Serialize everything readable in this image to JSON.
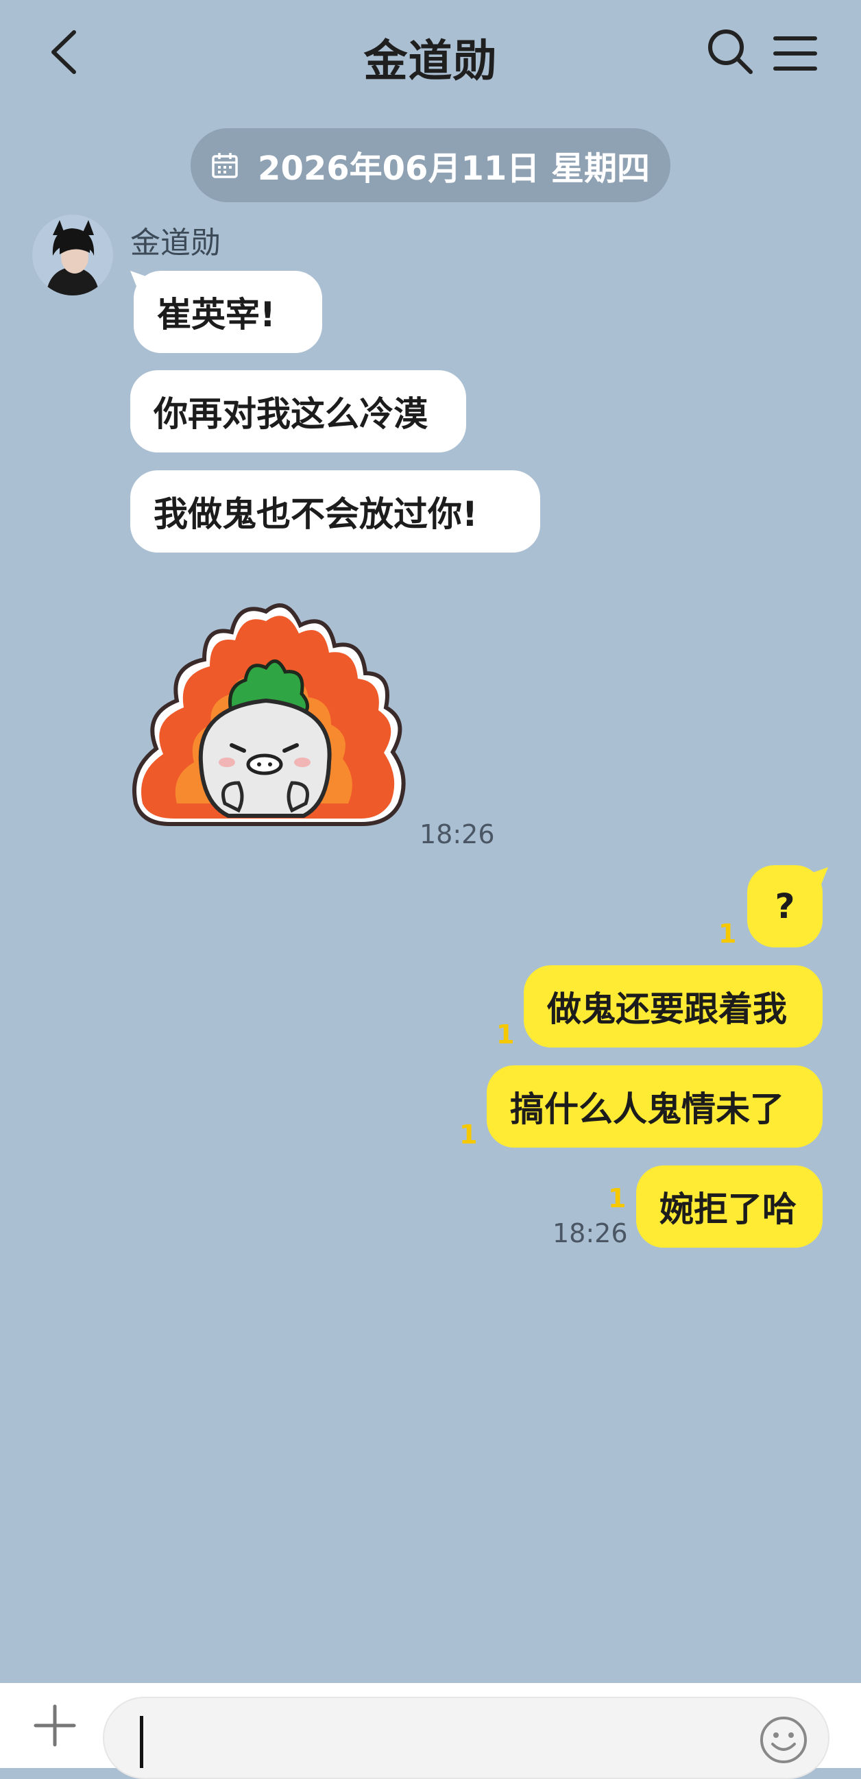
{
  "header": {
    "title": "金道勋",
    "back_icon": "chevron-left-icon",
    "search_icon": "search-icon",
    "menu_icon": "hamburger-menu-icon"
  },
  "date_divider": {
    "text": "2026年06月11日 星期四",
    "icon": "calendar-icon"
  },
  "incoming": {
    "sender_name": "金道勋",
    "messages": [
      "崔英宰!",
      "你再对我这么冷漠",
      "我做鬼也不会放过你!"
    ],
    "sticker": "angry-fire-sticker",
    "time": "18:26"
  },
  "outgoing": {
    "messages": [
      {
        "text": "?",
        "unread": "1"
      },
      {
        "text": "做鬼还要跟着我",
        "unread": "1"
      },
      {
        "text": "搞什么人鬼情未了",
        "unread": "1"
      },
      {
        "text": "婉拒了哈",
        "unread": "1"
      }
    ],
    "time": "18:26"
  },
  "composer": {
    "plus_icon": "plus-icon",
    "emoji_icon": "emoji-icon",
    "input_value": ""
  },
  "colors": {
    "background": "#abbfd2",
    "outgoing_bubble": "#ffeb33",
    "incoming_bubble": "#ffffff",
    "unread_badge": "#f5c800"
  }
}
